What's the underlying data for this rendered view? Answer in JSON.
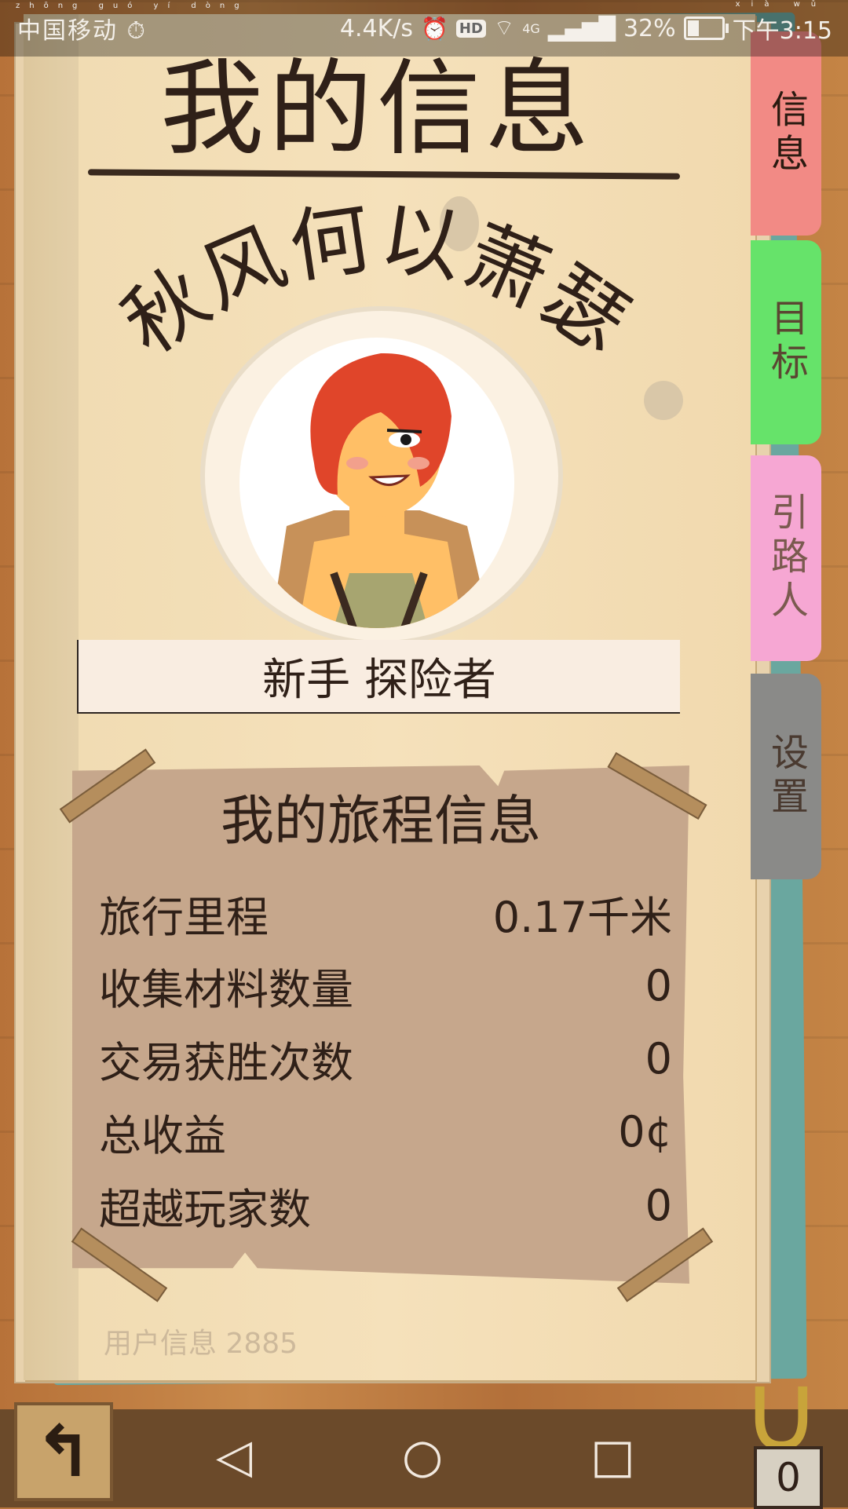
{
  "status_bar": {
    "carrier": "中国移动",
    "carrier_pinyin": "zhōng guó yí dòng",
    "net_speed": "4.4K/s",
    "battery": "32%",
    "time": "下午3:15",
    "time_pinyin": "xià wǔ",
    "network": "4G",
    "hd_badge": "HD"
  },
  "header": {
    "title": "我的信息",
    "username": "秋风何以萧瑟"
  },
  "rank": "新手 探险者",
  "tabs": [
    {
      "label": "信息",
      "color": "#f28a85"
    },
    {
      "label": "目标",
      "color": "#66e36a"
    },
    {
      "label": "引路人",
      "color": "#f6a7d3"
    },
    {
      "label": "设置",
      "color": "#8a8a88"
    }
  ],
  "journey": {
    "title": "我的旅程信息",
    "rows": [
      {
        "label": "旅行里程",
        "value": "0.17千米"
      },
      {
        "label": "收集材料数量",
        "value": "0"
      },
      {
        "label": "交易获胜次数",
        "value": "0"
      },
      {
        "label": "总收益",
        "value": "0¢"
      },
      {
        "label": "超越玩家数",
        "value": "0"
      }
    ]
  },
  "footer": {
    "user_id_text": "用户信息 2885",
    "back_icon": "undo-arrow-icon",
    "coin_count": "0"
  },
  "navbar": {
    "back": "◁",
    "home": "○",
    "recent": "□"
  }
}
